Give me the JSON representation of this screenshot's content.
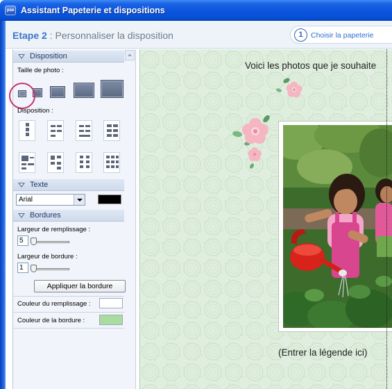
{
  "window": {
    "title": "Assistant Papeterie et dispositions",
    "app_icon_text": "pse"
  },
  "step": {
    "label": "Etape 2",
    "separator": " : ",
    "title": "Personnaliser la disposition",
    "nav_number": "1",
    "nav_link": "Choisir la papeterie"
  },
  "panel": {
    "disposition": {
      "header": "Disposition",
      "photo_size_label": "Taille de photo :",
      "layout_label": "Disposition :"
    },
    "texte": {
      "header": "Texte",
      "font_value": "Arial",
      "text_color": "#000000"
    },
    "bordures": {
      "header": "Bordures",
      "fill_width_label": "Largeur de remplissage :",
      "fill_width_value": "5",
      "border_width_label": "Largeur de bordure :",
      "border_width_value": "1",
      "apply_button": "Appliquer la bordure",
      "fill_color_label": "Couleur du remplissage :",
      "fill_color": "#ffffff",
      "border_color_label": "Couleur de la bordure :",
      "border_color": "#a9dca0"
    }
  },
  "canvas": {
    "title_text": "Voici les photos que je souhaite",
    "caption_placeholder": "(Entrer la légende ici)",
    "background_color": "#dfeede"
  },
  "colors": {
    "title_bar": "#0a55dc",
    "accent": "#3a74c8",
    "selection_ring": "#c6336f"
  }
}
